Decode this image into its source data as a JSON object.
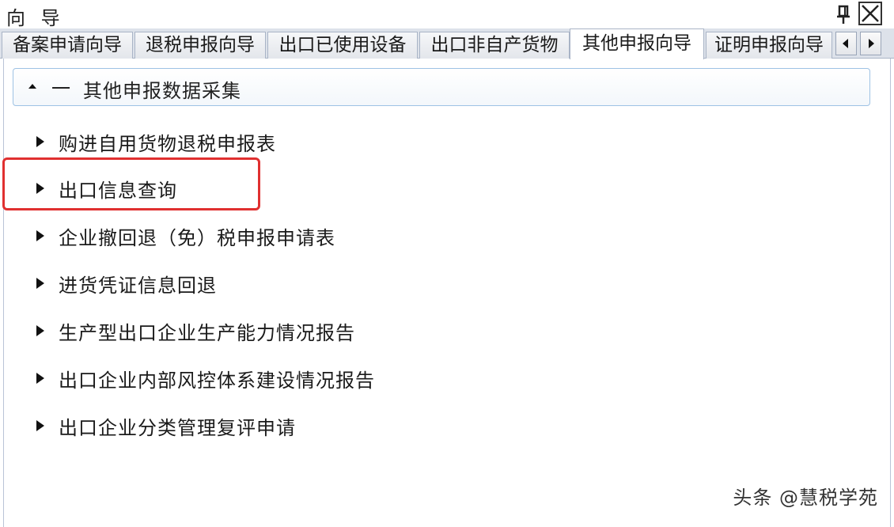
{
  "window": {
    "title": "向 导",
    "pin_icon": "pin-icon",
    "close_icon": "close-icon"
  },
  "tabs": [
    {
      "label": "备案申请向导",
      "active": false
    },
    {
      "label": "退税申报向导",
      "active": false
    },
    {
      "label": "出口已使用设备",
      "active": false
    },
    {
      "label": "出口非自产货物",
      "active": false
    },
    {
      "label": "其他申报向导",
      "active": true
    },
    {
      "label": "证明申报向导",
      "active": false
    }
  ],
  "tab_nav": {
    "prev_icon": "triangle-left-icon",
    "next_icon": "triangle-right-icon"
  },
  "group": {
    "dash": "一",
    "label": "其他申报数据采集",
    "expanded": true
  },
  "items": [
    {
      "label": "购进自用货物退税申报表"
    },
    {
      "label": "出口信息查询"
    },
    {
      "label": "企业撤回退（免）税申报申请表"
    },
    {
      "label": "进货凭证信息回退"
    },
    {
      "label": "生产型出口企业生产能力情况报告"
    },
    {
      "label": "出口企业内部风控体系建设情况报告"
    },
    {
      "label": "出口企业分类管理复评申请"
    }
  ],
  "highlight_color": "#e03030",
  "watermark": "头条 @慧税学苑"
}
